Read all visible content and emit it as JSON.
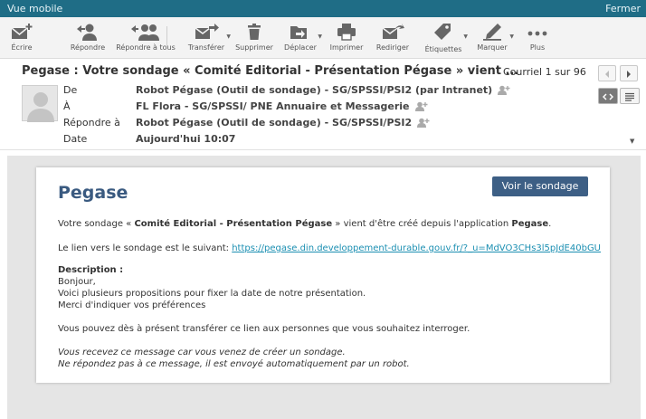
{
  "topbar": {
    "title": "Vue mobile",
    "close_label": "Fermer"
  },
  "toolbar": {
    "items": [
      {
        "label": "Écrire",
        "icon": "compose-icon"
      },
      {
        "label": "Répondre",
        "icon": "reply-icon"
      },
      {
        "label": "Répondre à tous",
        "icon": "reply-all-icon"
      },
      {
        "label": "Transférer",
        "icon": "forward-icon"
      },
      {
        "label": "Supprimer",
        "icon": "trash-icon"
      },
      {
        "label": "Déplacer",
        "icon": "move-folder-icon"
      },
      {
        "label": "Imprimer",
        "icon": "print-icon"
      },
      {
        "label": "Rediriger",
        "icon": "redirect-icon"
      },
      {
        "label": "Étiquettes",
        "icon": "tag-icon"
      },
      {
        "label": "Marquer",
        "icon": "pen-icon"
      },
      {
        "label": "Plus",
        "icon": "more-dots-icon"
      }
    ]
  },
  "message": {
    "subject": "Pegase : Votre sondage « Comité Editorial - Présentation Pégase » vient ...",
    "counter": "Courriel 1 sur 96",
    "fields": {
      "from_label": "De",
      "from_value": "Robot Pégase (Outil de sondage) - SG/SPSSI/PSI2 (par Intranet)",
      "to_label": "À",
      "to_value": "FL Flora - SG/SPSSI/ PNE Annuaire et Messagerie",
      "reply_label": "Répondre à",
      "reply_value": "Robot Pégase (Outil de sondage) - SG/SPSSI/PSI2",
      "date_label": "Date",
      "date_value": "Aujourd'hui 10:07"
    }
  },
  "body": {
    "title": "Pegase",
    "button_label": "Voir le sondage",
    "line1_pre": "Votre sondage « ",
    "line1_bold": "Comité Editorial - Présentation Pégase",
    "line1_mid": " » vient d'être créé depuis l'application ",
    "line1_app": "Pegase",
    "line1_end": ".",
    "link_intro": "Le lien vers le sondage est le suivant: ",
    "link_url": "https://pegase.din.developpement-durable.gouv.fr/?_u=MdVO3CHs3l5pJdE40bGU",
    "description_label": "Description :",
    "description_lines": [
      "Bonjour,",
      "Voici plusieurs propositions pour fixer la date de notre présentation.",
      "Merci d'indiquer vos préférences"
    ],
    "transfer_text": "Vous pouvez dès à présent transférer ce lien aux personnes que vous souhaitez interroger.",
    "footer_line1": "Vous recevez ce message car vous venez de créer un sondage.",
    "footer_line2": "Ne répondez pas à ce message, il est envoyé automatiquement par un robot."
  },
  "colors": {
    "topbar": "#1f6d86",
    "title": "#3a5a80",
    "button": "#3d5f85",
    "link": "#1b8fb2"
  }
}
